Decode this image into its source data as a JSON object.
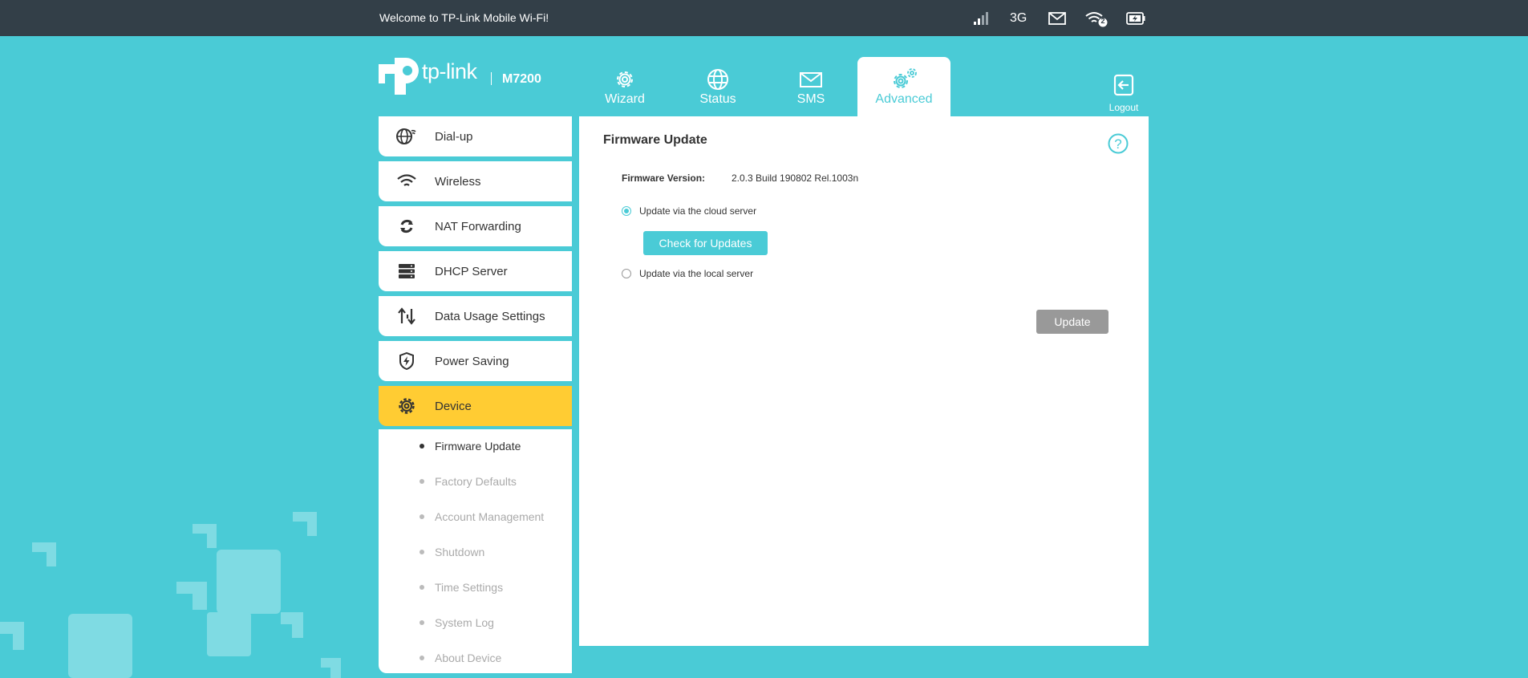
{
  "topbar": {
    "welcome": "Welcome to TP-Link Mobile Wi-Fi!",
    "network_type": "3G",
    "wifi_clients": "2",
    "icons": [
      "signal-icon",
      "mail-icon",
      "wifi-icon",
      "battery-charging-icon"
    ]
  },
  "logo": {
    "brand": "tp-link",
    "model": "M7200"
  },
  "nav": {
    "tabs": [
      {
        "label": "Wizard",
        "icon": "gear-icon"
      },
      {
        "label": "Status",
        "icon": "globe-icon"
      },
      {
        "label": "SMS",
        "icon": "envelope-icon"
      },
      {
        "label": "Advanced",
        "icon": "gears-icon",
        "active": true
      }
    ],
    "logout": "Logout"
  },
  "sidebar": {
    "items": [
      {
        "label": "Dial-up",
        "icon": "globe-signal-icon"
      },
      {
        "label": "Wireless",
        "icon": "wifi-icon"
      },
      {
        "label": "NAT Forwarding",
        "icon": "refresh-icon"
      },
      {
        "label": "DHCP Server",
        "icon": "server-icon"
      },
      {
        "label": "Data Usage Settings",
        "icon": "arrows-updown-icon"
      },
      {
        "label": "Power Saving",
        "icon": "shield-bolt-icon"
      },
      {
        "label": "Device",
        "icon": "gear-icon",
        "active": true
      }
    ],
    "submenu": [
      {
        "label": "Firmware Update",
        "active": true
      },
      {
        "label": "Factory Defaults"
      },
      {
        "label": "Account Management"
      },
      {
        "label": "Shutdown"
      },
      {
        "label": "Time Settings"
      },
      {
        "label": "System Log"
      },
      {
        "label": "About Device"
      }
    ]
  },
  "content": {
    "title": "Firmware Update",
    "firmware_label": "Firmware Version:",
    "firmware_value": "2.0.3 Build 190802 Rel.1003n",
    "option_cloud": "Update via the cloud server",
    "option_local": "Update via the local server",
    "check_button": "Check for Updates",
    "update_button": "Update",
    "help": "?"
  },
  "colors": {
    "background": "#4acbd6",
    "topbar": "#333f48",
    "accent": "#4acbd6",
    "active_sidebar": "#ffcc33",
    "disabled_button": "#999999"
  }
}
